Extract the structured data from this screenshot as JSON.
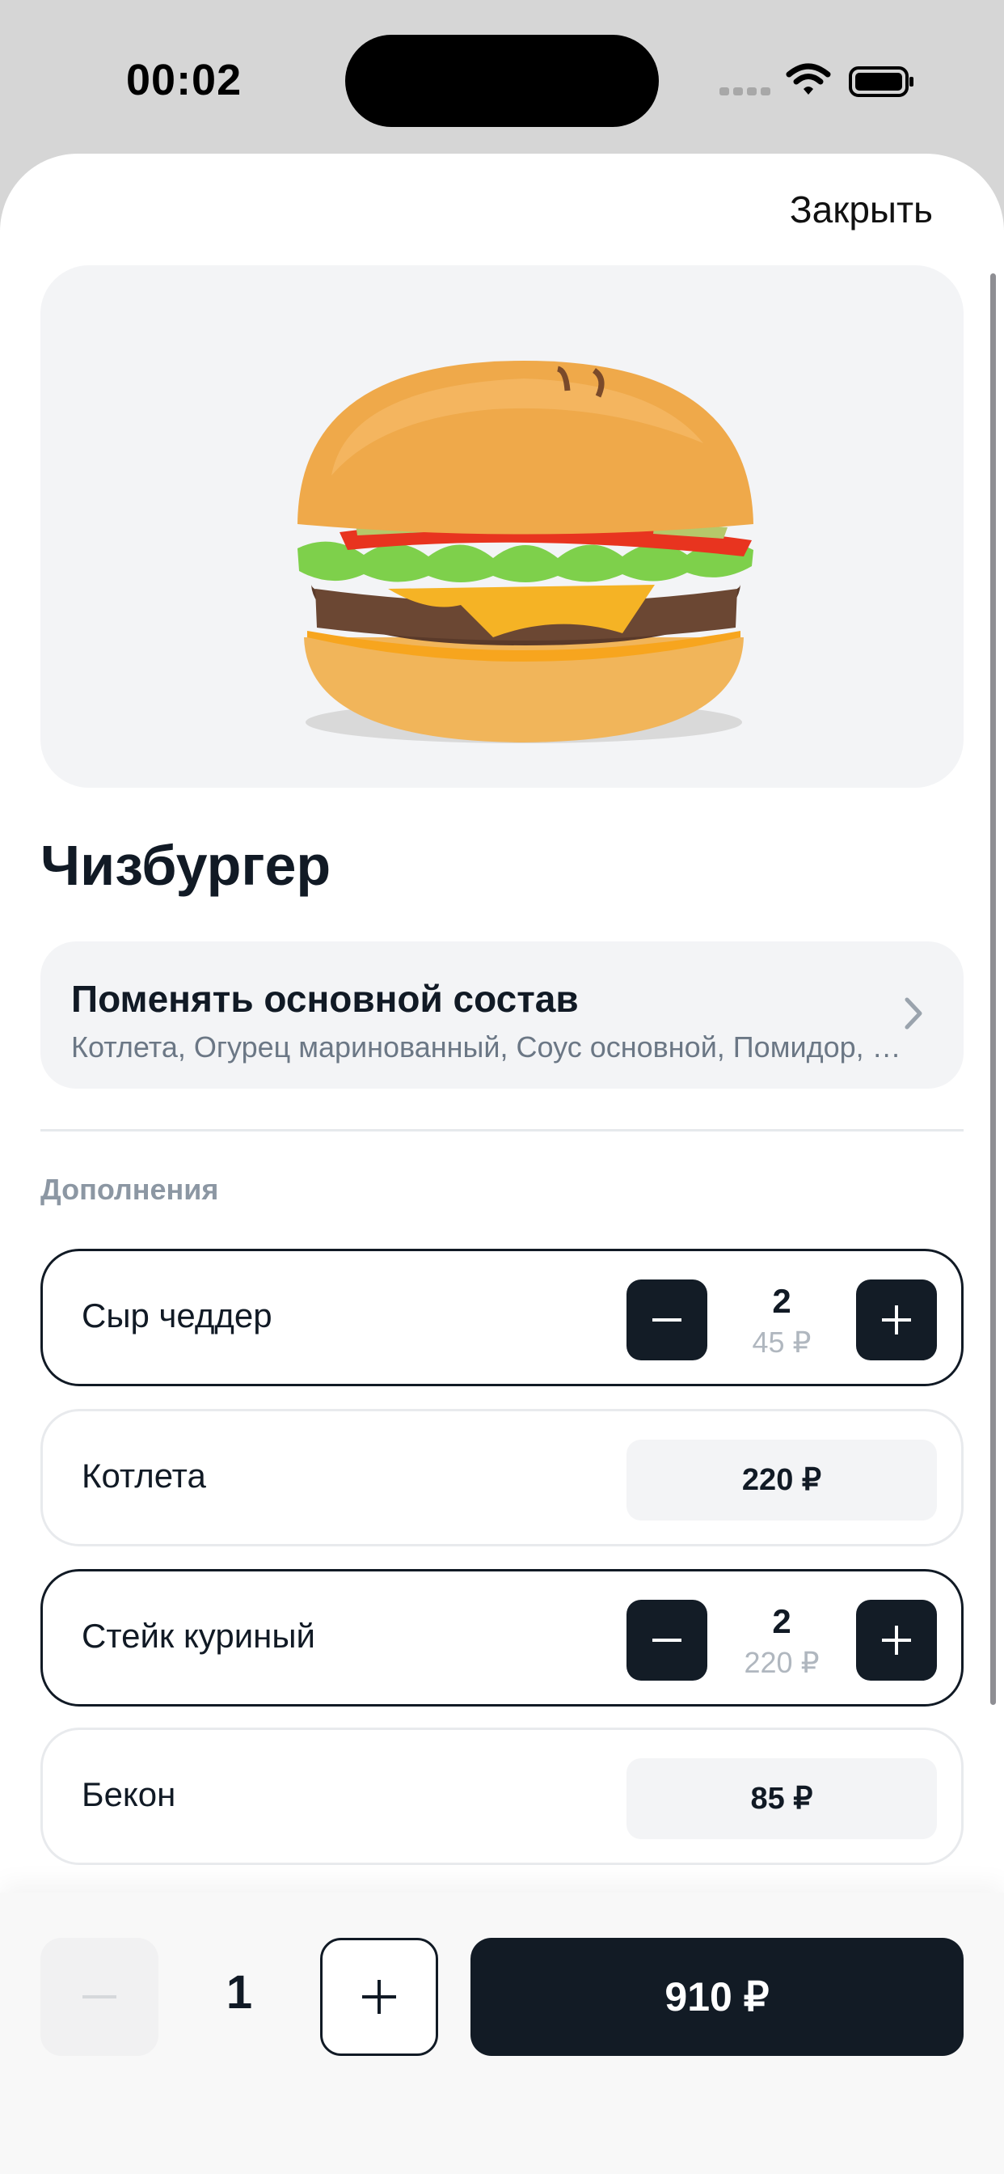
{
  "status_bar": {
    "time": "00:02"
  },
  "sheet": {
    "close_label": "Закрыть"
  },
  "product": {
    "title": "Чизбургер",
    "image_icon": "cheeseburger-photo"
  },
  "composition": {
    "title": "Поменять основной состав",
    "subtitle": "Котлета, Огурец маринованный, Соус основной, Помидор, Салат",
    "chevron_icon": "chevron-right-icon"
  },
  "addons_section": {
    "label": "Дополнения",
    "items": [
      {
        "name": "Сыр чеддер",
        "quantity": "2",
        "price": "45 ₽",
        "selected": true
      },
      {
        "name": "Котлета",
        "price": "220 ₽",
        "selected": false
      },
      {
        "name": "Стейк куриный",
        "quantity": "2",
        "price": "220 ₽",
        "selected": true
      },
      {
        "name": "Бекон",
        "price": "85 ₽",
        "selected": false
      }
    ]
  },
  "order": {
    "quantity": "1",
    "total": "910 ₽",
    "minus_disabled": true
  },
  "colors": {
    "dark": "#121b25",
    "light_surface": "#f3f4f6",
    "muted_text": "#8c97a3"
  }
}
